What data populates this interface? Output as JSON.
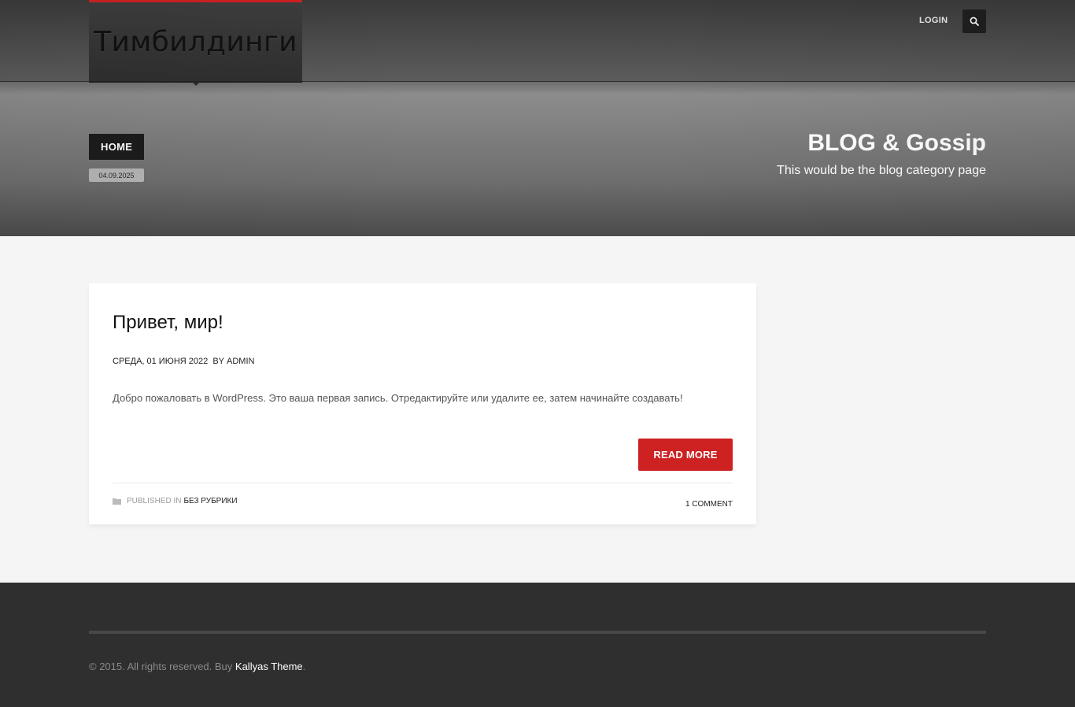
{
  "header": {
    "logo_text": "Тимбилдинги",
    "login_label": "LOGIN",
    "search_icon": "search-icon"
  },
  "hero": {
    "breadcrumb_home": "HOME",
    "date": "04.09.2025",
    "title": "BLOG & Gossip",
    "subtitle": "This would be the blog category page"
  },
  "post": {
    "title": "Привет, мир!",
    "meta_date": "СРЕДА, 01 ИЮНЯ 2022",
    "meta_by": "BY",
    "meta_author": "ADMIN",
    "excerpt": "Добро пожаловать в WordPress. Это ваша первая запись. Отредактируйте или удалите ее, затем начинайте создавать!",
    "read_more_label": "READ MORE",
    "published_in_label": "PUBLISHED IN",
    "category": "БЕЗ РУБРИКИ",
    "comments": "1 COMMENT",
    "folder_icon": "folder-icon"
  },
  "footer": {
    "copyright_text": "© 2015. All rights reserved. Buy",
    "theme_link": "Kallyas Theme",
    "trailing": "."
  },
  "colors": {
    "accent": "#cd2122",
    "footer_bg": "#2f2f2f",
    "page_bg": "#f5f5f5"
  }
}
